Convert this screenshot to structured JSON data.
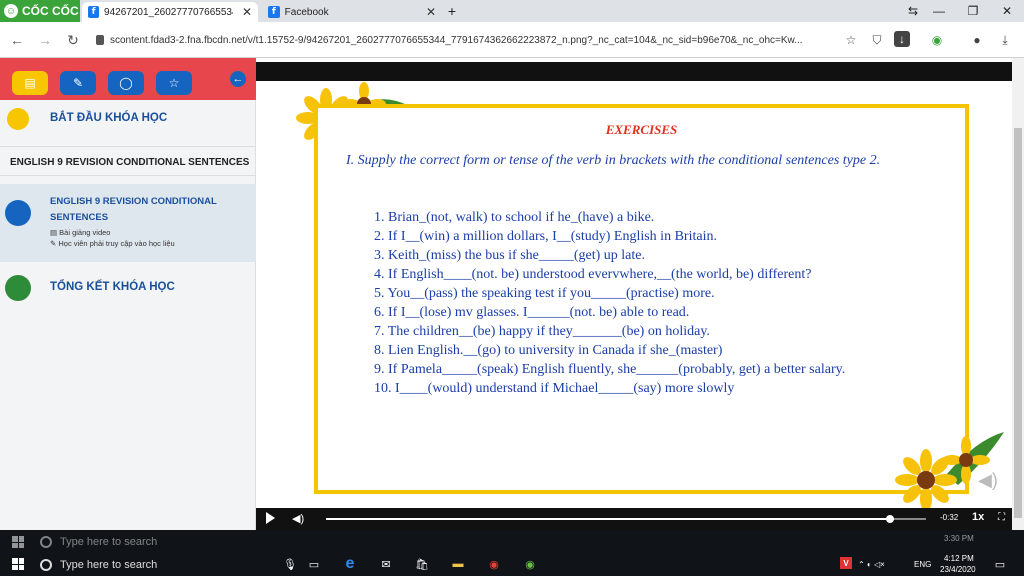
{
  "browser": {
    "brand": "CỐC CỐC",
    "tabs": [
      {
        "title": "94267201_2602777076655344"
      },
      {
        "title": "Facebook"
      }
    ],
    "url": "scontent.fdad3-2.fna.fbcdn.net/v/t1.15752-9/94267201_2602777076655344_7791674362662223872_n.png?_nc_cat=104&_nc_sid=b96e70&_nc_ohc=Kw..."
  },
  "sidebar": {
    "start_label": "BẮT ĐẦU KHÓA HỌC",
    "section_title": "ENGLISH 9 REVISION CONDITIONAL SENTENCES",
    "lesson": {
      "title_line1": "ENGLISH 9 REVISION CONDITIONAL",
      "title_line2": "SENTENCES",
      "meta1": "Bài giảng video",
      "meta2": "Học viên phải truy cập vào học liệu"
    },
    "summary_label": "TỔNG KẾT KHÓA HỌC"
  },
  "slide": {
    "title": "EXERCISES",
    "instruction": "I. Supply the correct form or tense of the verb in brackets with the conditional sentences type 2.",
    "items": [
      "1. Brian_(not, walk) to school if he_(have) a bike.",
      "2. If I__(win) a million dollars, I__(study) English in Britain.",
      "3. Keith_(miss) the bus if she_____(get) up late.",
      "4. If English____(not. be) understood evervwhere,__(the world, be) different?",
      "5. You__(pass) the speaking test if you_____(practise) more.",
      "6. If I__(lose) mv glasses. I______(not. be) able to read.",
      "7. The children__(be) happy if they_______(be) on holiday.",
      "8. Lien English.__(go) to university in Canada if she_(master)",
      "9. If Pamela_____(speak) English fluently, she______(probably, get) a better salary.",
      "10. I____(would) understand if Michael_____(say) more slowly"
    ]
  },
  "player": {
    "progress": 0.94,
    "time": "-0:32",
    "speed": "1x"
  },
  "taskbar": {
    "search_placeholder": "Type here to search",
    "search_ghost": "Type here to search",
    "lang": "ENG",
    "time_top": "3:30 PM",
    "time": "4:12 PM",
    "date": "23/4/2020"
  },
  "colors": {
    "brand_green": "#3aa43a",
    "sidebar_red": "#e8464d",
    "accent_blue": "#1565c0",
    "slide_border": "#f5c400",
    "text_blue": "#1b3ea8",
    "title_red": "#e0301e"
  }
}
